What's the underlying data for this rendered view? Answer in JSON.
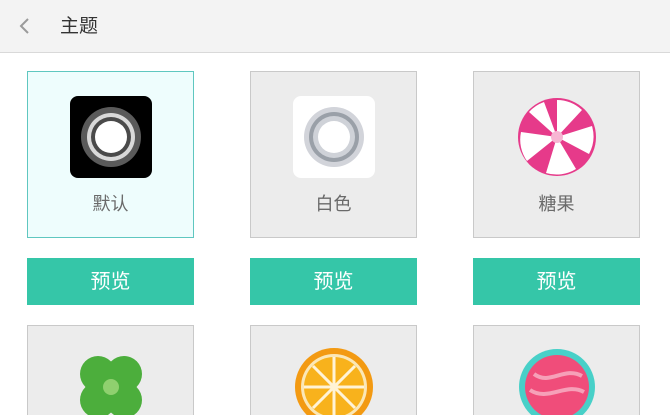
{
  "header": {
    "title": "主题"
  },
  "themes": [
    {
      "name": "默认",
      "preview_label": "预览",
      "selected": true
    },
    {
      "name": "白色",
      "preview_label": "预览",
      "selected": false
    },
    {
      "name": "糖果",
      "preview_label": "预览",
      "selected": false
    }
  ],
  "icons": {
    "back": "chevron-left-icon",
    "default": "dark-ring-icon",
    "white": "white-ring-icon",
    "candy": "candy-icon",
    "clover": "clover-icon",
    "orange": "orange-slice-icon",
    "pink": "pink-ball-icon"
  },
  "colors": {
    "accent": "#35c6a8",
    "selected_border": "#5fc7c0",
    "card_bg": "#ececec"
  }
}
